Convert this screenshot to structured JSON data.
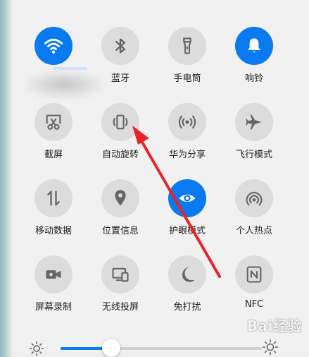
{
  "tiles": [
    {
      "id": "wifi",
      "label": "",
      "icon": "wifi-icon",
      "on": true
    },
    {
      "id": "bluetooth",
      "label": "蓝牙",
      "icon": "bluetooth-icon",
      "on": false
    },
    {
      "id": "flashlight",
      "label": "手电筒",
      "icon": "flashlight-icon",
      "on": false
    },
    {
      "id": "ring",
      "label": "响铃",
      "icon": "bell-icon",
      "on": true
    },
    {
      "id": "screenshot",
      "label": "截屏",
      "icon": "scissors-icon",
      "on": false
    },
    {
      "id": "autorotate",
      "label": "自动旋转",
      "icon": "rotate-phone-icon",
      "on": false
    },
    {
      "id": "huaweishare",
      "label": "华为分享",
      "icon": "share-signal-icon",
      "on": false
    },
    {
      "id": "airplane",
      "label": "飞行模式",
      "icon": "airplane-icon",
      "on": false
    },
    {
      "id": "mobiledata",
      "label": "移动数据",
      "icon": "data-arrows-icon",
      "on": false
    },
    {
      "id": "location",
      "label": "位置信息",
      "icon": "location-pin-icon",
      "on": false
    },
    {
      "id": "eyecare",
      "label": "护眼模式",
      "icon": "eye-icon",
      "on": true
    },
    {
      "id": "hotspot",
      "label": "个人热点",
      "icon": "hotspot-icon",
      "on": false
    },
    {
      "id": "screenrecord",
      "label": "屏幕录制",
      "icon": "video-camera-icon",
      "on": false
    },
    {
      "id": "wirelessprojection",
      "label": "无线投屏",
      "icon": "cast-screen-icon",
      "on": false
    },
    {
      "id": "dnd",
      "label": "免打扰",
      "icon": "moon-icon",
      "on": false
    },
    {
      "id": "nfc",
      "label": "NFC",
      "icon": "nfc-icon",
      "on": false
    }
  ],
  "brightness": {
    "level": 0.25
  },
  "watermark": "Bai经验",
  "colors": {
    "accent": "#0a7af0",
    "tile_off": "#dcdcdc",
    "arrow": "#e8232a"
  }
}
